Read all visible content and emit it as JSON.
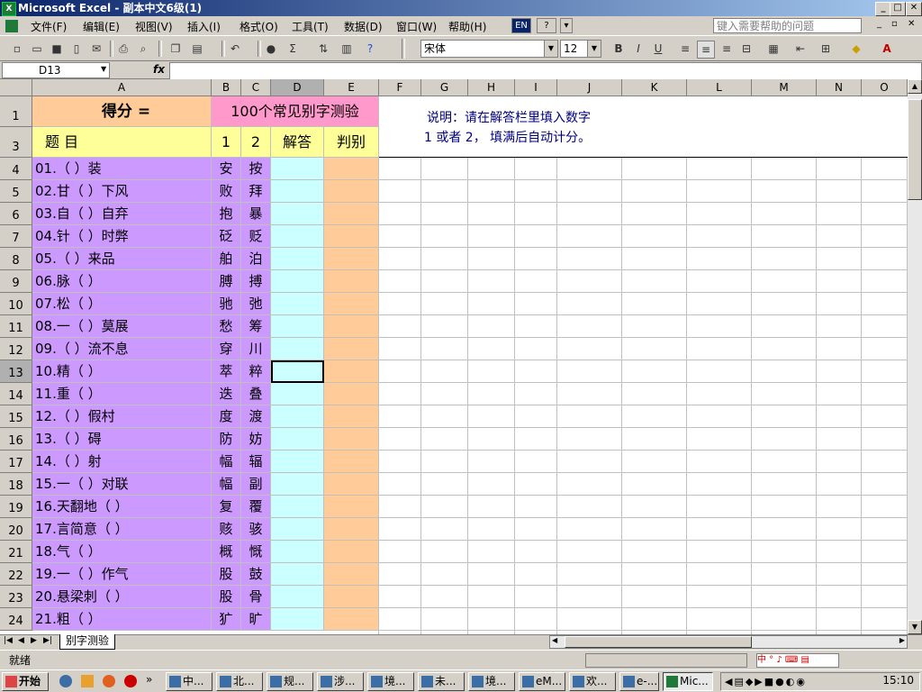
{
  "window": {
    "title": "Microsoft Excel - 副本中文6级(1)",
    "min_label": "_",
    "max_label": "□",
    "close_label": "✕",
    "app_icon": "X"
  },
  "menu": {
    "items": [
      "文件(F)",
      "编辑(E)",
      "视图(V)",
      "插入(I)",
      "格式(O)",
      "工具(T)",
      "数据(D)",
      "窗口(W)",
      "帮助(H)"
    ],
    "lang_badge": "EN",
    "help_badge": "?",
    "help_placeholder": "键入需要帮助的问题"
  },
  "toolbar": {
    "font_name": "宋体",
    "font_size": "12",
    "sigma": "Σ"
  },
  "formula": {
    "name_box": "D13",
    "fx": "fx",
    "value": ""
  },
  "columns": [
    "A",
    "B",
    "C",
    "D",
    "E",
    "F",
    "G",
    "H",
    "I",
    "J",
    "K",
    "L",
    "M",
    "N",
    "O"
  ],
  "header_cells": {
    "score_label": "得分 =",
    "test_title": "100个常见别字测验",
    "note_line1": "说明：请在解答栏里填入数字",
    "note_line2": "1 或者 2， 填满后自动计分。",
    "col_topic": "题 目",
    "col_1": "1",
    "col_2": "2",
    "col_answer": "解答",
    "col_judge": "判别"
  },
  "row_numbers": [
    "1",
    "3",
    "4",
    "5",
    "6",
    "7",
    "8",
    "9",
    "10",
    "11",
    "12",
    "13",
    "14",
    "15",
    "16",
    "17",
    "18",
    "19",
    "20",
    "21",
    "22",
    "23",
    "24"
  ],
  "questions": [
    {
      "topic": "01.（ ）装",
      "c1": "安",
      "c2": "按"
    },
    {
      "topic": "02.甘（ ）下风",
      "c1": "败",
      "c2": "拜"
    },
    {
      "topic": "03.自（ ）自弃",
      "c1": "抱",
      "c2": "暴"
    },
    {
      "topic": "04.针（ ）时弊",
      "c1": "砭",
      "c2": "贬"
    },
    {
      "topic": "05.（ ）来品",
      "c1": "舶",
      "c2": "泊"
    },
    {
      "topic": "06.脉（ ）",
      "c1": "膊",
      "c2": "搏"
    },
    {
      "topic": "07.松（ ）",
      "c1": "驰",
      "c2": "弛"
    },
    {
      "topic": "08.一（ ）莫展",
      "c1": "愁",
      "c2": "筹"
    },
    {
      "topic": "09.（ ）流不息",
      "c1": "穿",
      "c2": "川"
    },
    {
      "topic": "10.精（ ）",
      "c1": "萃",
      "c2": "粹"
    },
    {
      "topic": "11.重（ ）",
      "c1": "迭",
      "c2": "叠"
    },
    {
      "topic": "12.（ ）假村",
      "c1": "度",
      "c2": "渡"
    },
    {
      "topic": "13.（ ）碍",
      "c1": "防",
      "c2": "妨"
    },
    {
      "topic": "14.（ ）射",
      "c1": "幅",
      "c2": "辐"
    },
    {
      "topic": "15.一（ ）对联",
      "c1": "幅",
      "c2": "副"
    },
    {
      "topic": "16.天翻地（ ）",
      "c1": "复",
      "c2": "覆"
    },
    {
      "topic": "17.言简意（ ）",
      "c1": "赅",
      "c2": "骇"
    },
    {
      "topic": "18.气（ ）",
      "c1": "概",
      "c2": "慨"
    },
    {
      "topic": "19.一（ ）作气",
      "c1": "股",
      "c2": "鼓"
    },
    {
      "topic": "20.悬梁刺（ ）",
      "c1": "股",
      "c2": "骨"
    },
    {
      "topic": "21.粗（ ）",
      "c1": "犷",
      "c2": "旷"
    }
  ],
  "sheet_tab": "别字测验",
  "status": {
    "ready": "就绪"
  },
  "taskbar": {
    "start": "开始",
    "tasks": [
      "中...",
      "北...",
      "规...",
      "涉...",
      "境...",
      "未...",
      "境...",
      "eM...",
      "欢...",
      "e-...",
      "Mic..."
    ],
    "clock": "15:10"
  },
  "colors": {
    "orange": "#ffcc99",
    "pink": "#ff99cc",
    "yellow": "#ffff99",
    "lavender": "#cc99ff",
    "cyan": "#ccffff",
    "note_blue": "#000080"
  }
}
